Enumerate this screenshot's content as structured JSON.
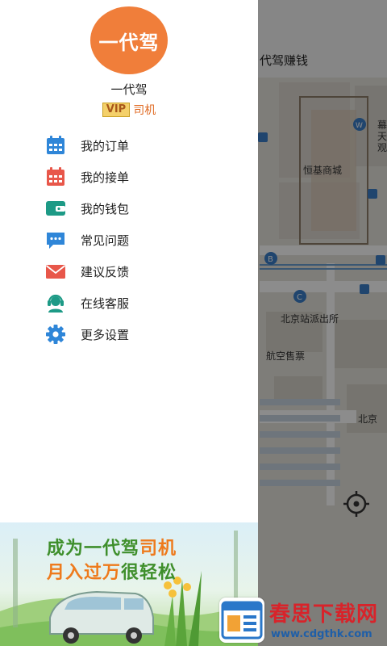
{
  "map": {
    "title": "代驾赚钱",
    "labels": {
      "mall": "恒基商城",
      "police": "北京站派出所",
      "ticket": "航空售票",
      "street": "北京",
      "side_text": "幕天观"
    }
  },
  "drawer": {
    "logo_text": "一代驾",
    "user_name": "一代驾",
    "vip_badge": "VIP",
    "role": "司机",
    "menu": [
      {
        "label": "我的订单",
        "icon": "calendar-icon"
      },
      {
        "label": "我的接单",
        "icon": "calendar-icon"
      },
      {
        "label": "我的钱包",
        "icon": "wallet-icon"
      },
      {
        "label": "常见问题",
        "icon": "chat-bubble-icon"
      },
      {
        "label": "建议反馈",
        "icon": "envelope-icon"
      },
      {
        "label": "在线客服",
        "icon": "headset-icon"
      },
      {
        "label": "更多设置",
        "icon": "gear-icon"
      }
    ]
  },
  "banner": {
    "line1_part1": "成为一代驾",
    "line1_part2": "司机",
    "line2_part1": "月入过万",
    "line2_part2": "很轻松"
  },
  "watermark": {
    "title": "春思下载网",
    "url": "www.cdgthk.com"
  },
  "colors": {
    "accent_orange": "#f07e3a",
    "icon_blue": "#2f86d8",
    "icon_red": "#e8574a",
    "icon_teal": "#1d9a86"
  }
}
